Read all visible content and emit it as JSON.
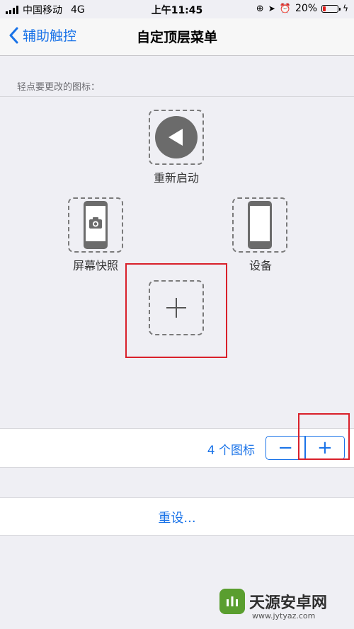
{
  "status_bar": {
    "carrier": "中国移动",
    "network": "4G",
    "time": "上午11:45",
    "battery_percent": "20%",
    "battery_level": 0.2,
    "battery_color": "#e0201c"
  },
  "nav": {
    "back_label": "辅助触控",
    "title": "自定顶层菜单"
  },
  "section_header": "轻点要更改的图标：",
  "slots": {
    "top": {
      "label": "重新启动",
      "icon": "restart-icon"
    },
    "left": {
      "label": "屏幕快照",
      "icon": "screenshot-icon"
    },
    "right": {
      "label": "设备",
      "icon": "device-icon"
    },
    "center": {
      "label": "",
      "icon": "plus-icon"
    }
  },
  "count_row": {
    "label": "4 个图标",
    "minus": "−",
    "plus": "+"
  },
  "reset_label": "重设...",
  "watermark": {
    "text": "天源安卓网",
    "url": "www.jytyaz.com"
  },
  "colors": {
    "accent": "#1a73e8",
    "highlight": "#d9202a",
    "background": "#efeff4"
  }
}
